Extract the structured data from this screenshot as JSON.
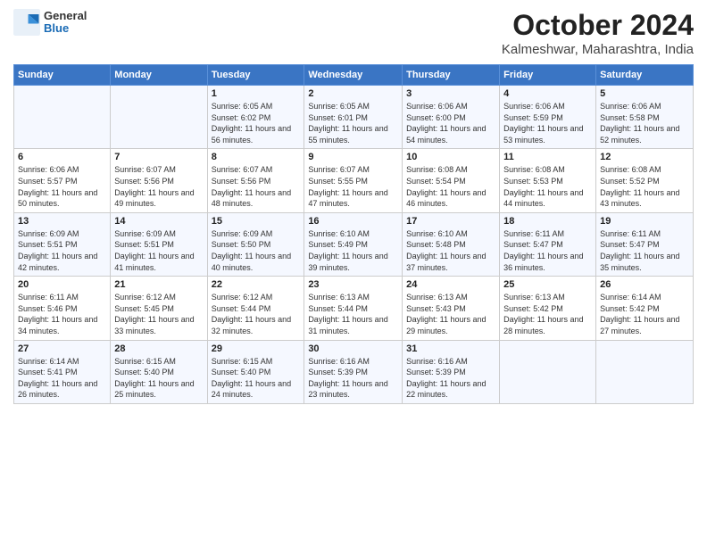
{
  "header": {
    "logo": {
      "general": "General",
      "blue": "Blue"
    },
    "title": "October 2024",
    "subtitle": "Kalmeshwar, Maharashtra, India"
  },
  "weekdays": [
    "Sunday",
    "Monday",
    "Tuesday",
    "Wednesday",
    "Thursday",
    "Friday",
    "Saturday"
  ],
  "weeks": [
    [
      {
        "day": "",
        "info": ""
      },
      {
        "day": "",
        "info": ""
      },
      {
        "day": "1",
        "sunrise": "6:05 AM",
        "sunset": "6:02 PM",
        "daylight": "11 hours and 56 minutes."
      },
      {
        "day": "2",
        "sunrise": "6:05 AM",
        "sunset": "6:01 PM",
        "daylight": "11 hours and 55 minutes."
      },
      {
        "day": "3",
        "sunrise": "6:06 AM",
        "sunset": "6:00 PM",
        "daylight": "11 hours and 54 minutes."
      },
      {
        "day": "4",
        "sunrise": "6:06 AM",
        "sunset": "5:59 PM",
        "daylight": "11 hours and 53 minutes."
      },
      {
        "day": "5",
        "sunrise": "6:06 AM",
        "sunset": "5:58 PM",
        "daylight": "11 hours and 52 minutes."
      }
    ],
    [
      {
        "day": "6",
        "sunrise": "6:06 AM",
        "sunset": "5:57 PM",
        "daylight": "11 hours and 50 minutes."
      },
      {
        "day": "7",
        "sunrise": "6:07 AM",
        "sunset": "5:56 PM",
        "daylight": "11 hours and 49 minutes."
      },
      {
        "day": "8",
        "sunrise": "6:07 AM",
        "sunset": "5:56 PM",
        "daylight": "11 hours and 48 minutes."
      },
      {
        "day": "9",
        "sunrise": "6:07 AM",
        "sunset": "5:55 PM",
        "daylight": "11 hours and 47 minutes."
      },
      {
        "day": "10",
        "sunrise": "6:08 AM",
        "sunset": "5:54 PM",
        "daylight": "11 hours and 46 minutes."
      },
      {
        "day": "11",
        "sunrise": "6:08 AM",
        "sunset": "5:53 PM",
        "daylight": "11 hours and 44 minutes."
      },
      {
        "day": "12",
        "sunrise": "6:08 AM",
        "sunset": "5:52 PM",
        "daylight": "11 hours and 43 minutes."
      }
    ],
    [
      {
        "day": "13",
        "sunrise": "6:09 AM",
        "sunset": "5:51 PM",
        "daylight": "11 hours and 42 minutes."
      },
      {
        "day": "14",
        "sunrise": "6:09 AM",
        "sunset": "5:51 PM",
        "daylight": "11 hours and 41 minutes."
      },
      {
        "day": "15",
        "sunrise": "6:09 AM",
        "sunset": "5:50 PM",
        "daylight": "11 hours and 40 minutes."
      },
      {
        "day": "16",
        "sunrise": "6:10 AM",
        "sunset": "5:49 PM",
        "daylight": "11 hours and 39 minutes."
      },
      {
        "day": "17",
        "sunrise": "6:10 AM",
        "sunset": "5:48 PM",
        "daylight": "11 hours and 37 minutes."
      },
      {
        "day": "18",
        "sunrise": "6:11 AM",
        "sunset": "5:47 PM",
        "daylight": "11 hours and 36 minutes."
      },
      {
        "day": "19",
        "sunrise": "6:11 AM",
        "sunset": "5:47 PM",
        "daylight": "11 hours and 35 minutes."
      }
    ],
    [
      {
        "day": "20",
        "sunrise": "6:11 AM",
        "sunset": "5:46 PM",
        "daylight": "11 hours and 34 minutes."
      },
      {
        "day": "21",
        "sunrise": "6:12 AM",
        "sunset": "5:45 PM",
        "daylight": "11 hours and 33 minutes."
      },
      {
        "day": "22",
        "sunrise": "6:12 AM",
        "sunset": "5:44 PM",
        "daylight": "11 hours and 32 minutes."
      },
      {
        "day": "23",
        "sunrise": "6:13 AM",
        "sunset": "5:44 PM",
        "daylight": "11 hours and 31 minutes."
      },
      {
        "day": "24",
        "sunrise": "6:13 AM",
        "sunset": "5:43 PM",
        "daylight": "11 hours and 29 minutes."
      },
      {
        "day": "25",
        "sunrise": "6:13 AM",
        "sunset": "5:42 PM",
        "daylight": "11 hours and 28 minutes."
      },
      {
        "day": "26",
        "sunrise": "6:14 AM",
        "sunset": "5:42 PM",
        "daylight": "11 hours and 27 minutes."
      }
    ],
    [
      {
        "day": "27",
        "sunrise": "6:14 AM",
        "sunset": "5:41 PM",
        "daylight": "11 hours and 26 minutes."
      },
      {
        "day": "28",
        "sunrise": "6:15 AM",
        "sunset": "5:40 PM",
        "daylight": "11 hours and 25 minutes."
      },
      {
        "day": "29",
        "sunrise": "6:15 AM",
        "sunset": "5:40 PM",
        "daylight": "11 hours and 24 minutes."
      },
      {
        "day": "30",
        "sunrise": "6:16 AM",
        "sunset": "5:39 PM",
        "daylight": "11 hours and 23 minutes."
      },
      {
        "day": "31",
        "sunrise": "6:16 AM",
        "sunset": "5:39 PM",
        "daylight": "11 hours and 22 minutes."
      },
      {
        "day": "",
        "info": ""
      },
      {
        "day": "",
        "info": ""
      }
    ]
  ]
}
